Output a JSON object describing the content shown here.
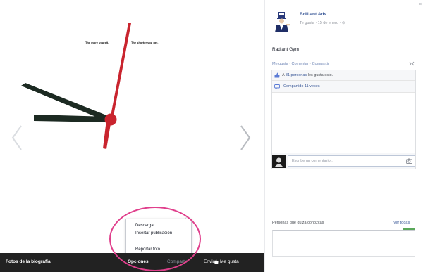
{
  "viewer": {
    "slogan_left": "The more you sit.",
    "slogan_right": "The shorter you get.",
    "album_title": "Fotos de la biografía",
    "actions": {
      "options": "Opciones",
      "share": "Compartir",
      "send": "Enviar",
      "like": "Me gusta"
    },
    "options_menu": {
      "items": [
        "Descargar",
        "Insertar publicación",
        "Reportar foto"
      ]
    }
  },
  "post": {
    "page_name": "Brilliant Ads",
    "meta": "Te gusta · 15 de enero · ⊘",
    "text": "Radiant Gym",
    "actions": [
      "Me gusta",
      "Comentar",
      "Compartir"
    ],
    "likes_prefix": "A ",
    "likes_link": "81 personas",
    "likes_suffix": " les gusta esto.",
    "shares": "Compartido 11 veces",
    "comment_placeholder": "Escribe un comentario..."
  },
  "sidebar": {
    "close_glyph": "×",
    "pymk_title": "Personas que quizá conozcas",
    "pymk_see_all": "Ver todas"
  },
  "colors": {
    "link": "#3b5998",
    "bar": "#222222",
    "highlight": "#e03f8c",
    "clock_hand_red": "#c9242e"
  },
  "icons": {
    "nav_prev": "chevron-left-icon",
    "nav_next": "chevron-right-icon",
    "like": "thumbs-up-icon",
    "share": "share-icon",
    "camera": "camera-icon",
    "close": "close-icon"
  }
}
